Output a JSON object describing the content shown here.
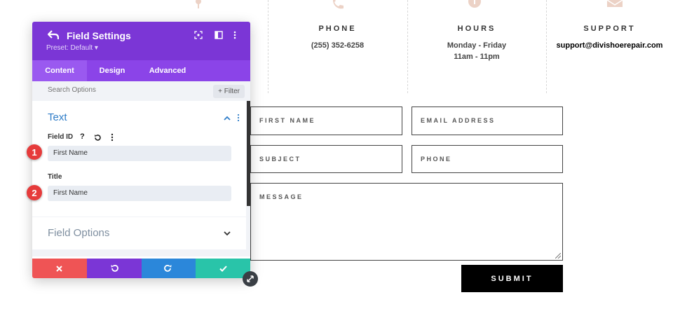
{
  "contact": {
    "phone": {
      "title": "PHONE",
      "value": "(255) 352-6258"
    },
    "hours": {
      "title": "HOURS",
      "line1": "Monday - Friday",
      "line2": "11am - 11pm"
    },
    "support": {
      "title": "SUPPORT",
      "value": "support@divishoerepair.com"
    }
  },
  "form": {
    "first_name": "FIRST NAME",
    "email": "EMAIL ADDRESS",
    "subject": "SUBJECT",
    "phone": "PHONE",
    "message": "MESSAGE",
    "submit": "SUBMIT"
  },
  "modal": {
    "title": "Field Settings",
    "preset": "Preset: Default ▾",
    "tabs": [
      "Content",
      "Design",
      "Advanced"
    ],
    "search_placeholder": "Search Options",
    "filter_label": "+ Filter",
    "section_text": "Text",
    "field_id_label": "Field ID",
    "field_id_value": "First Name",
    "title_label": "Title",
    "title_value": "First Name",
    "section_field_options": "Field Options",
    "icons": {
      "help": "?",
      "reset": "reset-icon",
      "more": "more-icon"
    }
  },
  "annotations": {
    "one": "1",
    "two": "2"
  },
  "colors": {
    "modal_header": "#7b36d6",
    "tabs": "#8b44e8",
    "cancel": "#ef5455",
    "undo": "#7b36d6",
    "redo": "#2b87da",
    "save": "#29c4a9",
    "section_title": "#2f7dc8",
    "badge": "#e63b3b"
  }
}
